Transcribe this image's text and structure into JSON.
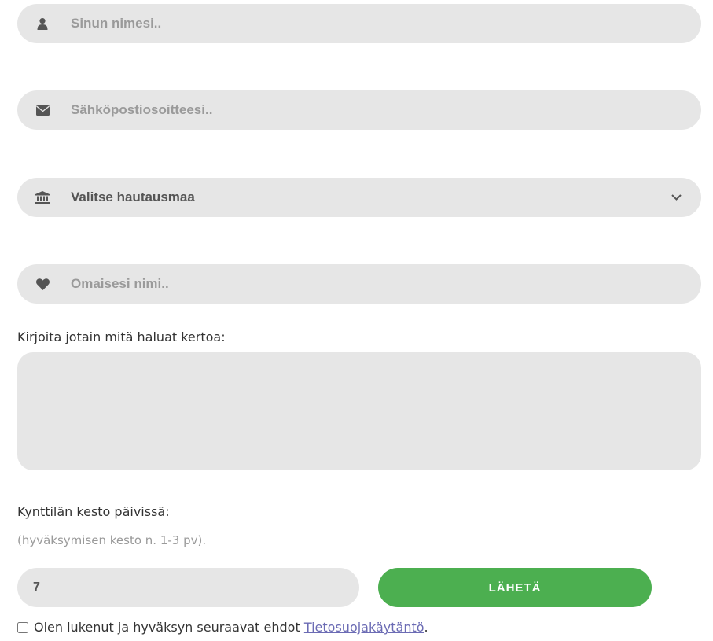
{
  "form": {
    "name_placeholder": "Sinun nimesi..",
    "email_placeholder": "Sähköpostiosoitteesi..",
    "cemetery_select_label": "Valitse hautausmaa",
    "relative_placeholder": "Omaisesi nimi..",
    "message_label": "Kirjoita jotain mitä haluat kertoa:",
    "duration_label": "Kynttilän kesto päivissä:",
    "duration_hint": "(hyväksymisen kesto n. 1-3 pv).",
    "duration_value": "7",
    "submit_label": "LÄHETÄ",
    "consent_text": "Olen lukenut ja hyväksyn seuraavat ehdot",
    "consent_link": "Tietosuojakäytäntö",
    "consent_end": "."
  },
  "icons": {
    "name": "user-icon",
    "email": "envelope-icon",
    "cemetery": "institution-icon",
    "relative": "heart-icon",
    "select_arrow": "chevron-down-icon"
  },
  "colors": {
    "field_bg": "#e6e6e6",
    "submit_bg": "#4caf50",
    "link": "#6b6bb4"
  }
}
